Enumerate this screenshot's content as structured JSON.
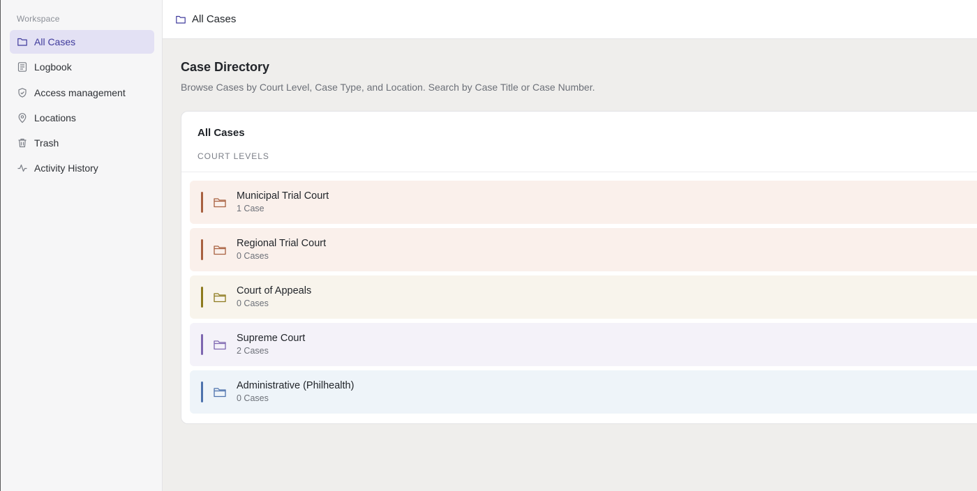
{
  "sidebar": {
    "section_label": "Workspace",
    "items": [
      {
        "label": "All Cases",
        "icon": "folder-icon",
        "active": true
      },
      {
        "label": "Logbook",
        "icon": "logbook-icon"
      },
      {
        "label": "Access management",
        "icon": "shield-icon"
      },
      {
        "label": "Locations",
        "icon": "map-pin-icon"
      },
      {
        "label": "Trash",
        "icon": "trash-icon"
      },
      {
        "label": "Activity History",
        "icon": "activity-icon"
      }
    ]
  },
  "topbar": {
    "title": "All Cases",
    "icon": "folder-icon"
  },
  "header": {
    "title": "Case Directory",
    "subtitle": "Browse Cases by Court Level, Case Type, and Location. Search by Case Title or Case Number."
  },
  "card": {
    "title": "All Cases",
    "section_label": "COURT LEVELS",
    "courts": [
      {
        "name": "Municipal Trial Court",
        "count": "1 Case",
        "accent": "#a8603f",
        "bg": "#faf0eb"
      },
      {
        "name": "Regional Trial Court",
        "count": "0 Cases",
        "accent": "#a8603f",
        "bg": "#faf0eb"
      },
      {
        "name": "Court of Appeals",
        "count": "0 Cases",
        "accent": "#8d7a1e",
        "bg": "#f8f4ec"
      },
      {
        "name": "Supreme Court",
        "count": "2 Cases",
        "accent": "#7d66b0",
        "bg": "#f4f2f9"
      },
      {
        "name": "Administrative (Philhealth)",
        "count": "0 Cases",
        "accent": "#4d72ad",
        "bg": "#eef4f9"
      }
    ]
  },
  "colors": {
    "accent": "#3f3a9c",
    "active_bg": "#e3e1f4"
  }
}
